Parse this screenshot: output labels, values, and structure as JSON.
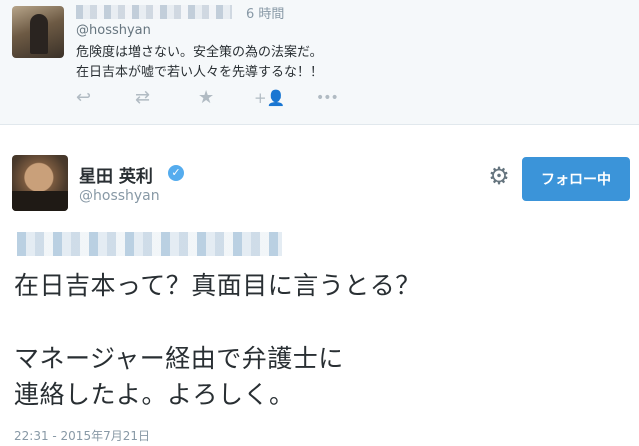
{
  "reply_tweet": {
    "time": "6 時間",
    "handle": "@hosshyan",
    "text_line1": "危険度は増さない。安全策の為の法案だ。",
    "text_line2": "在日吉本が嘘で若い人々を先導するな！！",
    "actions": [
      {
        "name": "reply-icon",
        "glyph": "↩"
      },
      {
        "name": "retweet-icon",
        "glyph": "⇄"
      },
      {
        "name": "favorite-icon",
        "glyph": "★"
      },
      {
        "name": "follow-icon",
        "glyph": "+👤"
      },
      {
        "name": "more-icon",
        "glyph": "•••"
      }
    ]
  },
  "main_tweet": {
    "name": "星田 英利",
    "verified_glyph": "✓",
    "handle": "@hosshyan",
    "follow_label": "フォロー中",
    "gear_glyph": "⚙",
    "line1": "在日吉本って？真面目に言うとる？",
    "line2": "マネージャー経由で弁護士に",
    "line3": "連絡したよ。よろしく。",
    "timestamp": "22:31 - 2015年7月21日"
  },
  "colors": {
    "accent": "#55acee",
    "button": "#3b94d9",
    "muted": "#8899a6",
    "text": "#292f33",
    "reply_bg": "#f5f8fa"
  }
}
